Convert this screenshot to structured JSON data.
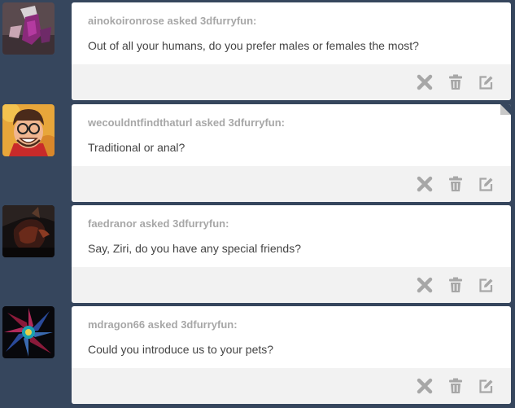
{
  "asks": [
    {
      "asker": "ainokoironrose",
      "asked_text": "asked",
      "recipient": "3dfurryfun:",
      "question": "Out of all your humans, do you prefer males or females the most?"
    },
    {
      "asker": "wecouldntfindthaturl",
      "asked_text": "asked",
      "recipient": "3dfurryfun:",
      "question": "Traditional or anal?"
    },
    {
      "asker": "faedranor",
      "asked_text": "asked",
      "recipient": "3dfurryfun:",
      "question": "Say, Ziri, do you have any special friends?"
    },
    {
      "asker": "mdragon66",
      "asked_text": "asked",
      "recipient": "3dfurryfun:",
      "question": "Could you introduce us to your pets?"
    }
  ],
  "controls": {
    "ignore_icon": "x-icon",
    "delete_icon": "trash-icon",
    "edit_icon": "edit-icon"
  },
  "colors": {
    "page_background": "#36465d",
    "card_background": "#ffffff",
    "footer_background": "#f2f2f2",
    "asker_text": "#a7a7a7",
    "question_text": "#444444",
    "icon": "#a7a7a7"
  }
}
